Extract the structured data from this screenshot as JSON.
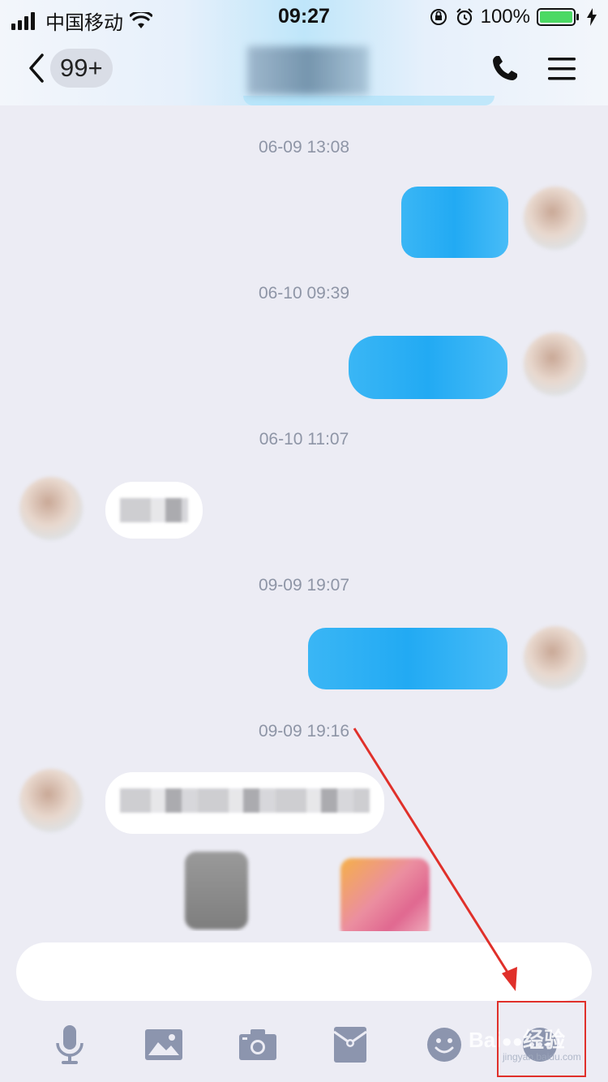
{
  "status_bar": {
    "carrier": "中国移动",
    "time": "09:27",
    "battery": "100%"
  },
  "header": {
    "unread_badge": "99+"
  },
  "messages": {
    "timestamps": [
      "06-09 13:08",
      "06-10 09:39",
      "06-10 11:07",
      "09-09 19:07",
      "09-09 19:16"
    ]
  },
  "toolbar": {
    "icons": [
      "microphone-icon",
      "image-icon",
      "camera-icon",
      "red-packet-icon",
      "emoji-icon",
      "more-icon"
    ]
  },
  "watermark": {
    "text": "Bai",
    "text2": "经验",
    "sub": "jingyan.baidu.com"
  },
  "colors": {
    "accent": "#22AAF3",
    "background": "#ECECF4",
    "timestamp": "#8E95A6",
    "annotation": "#E0302A"
  }
}
